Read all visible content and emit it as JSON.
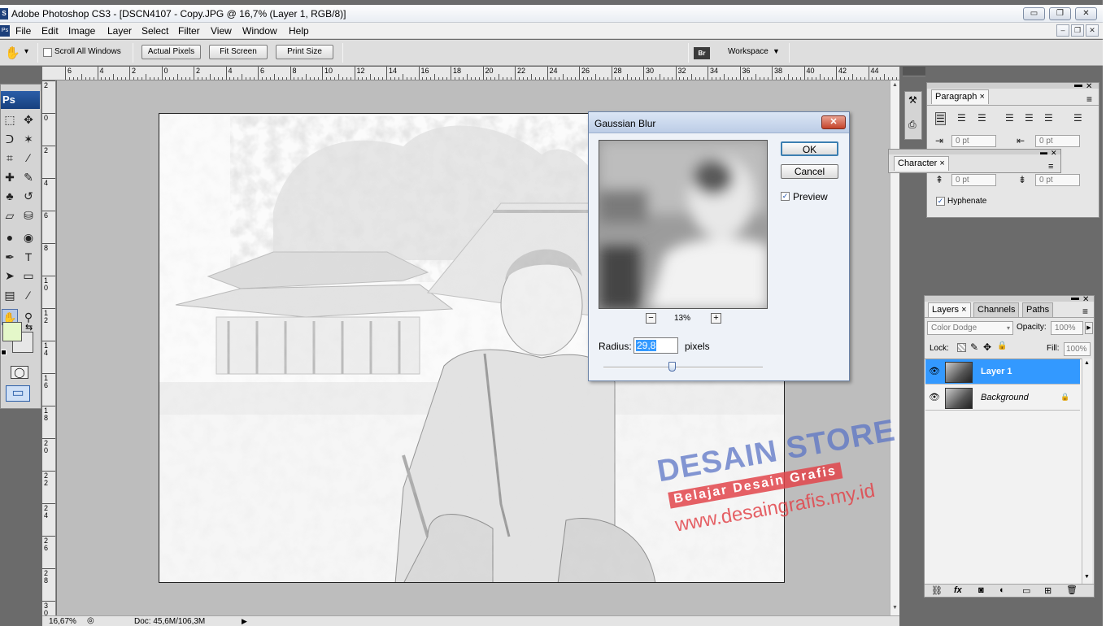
{
  "app": {
    "title": "Adobe Photoshop CS3 - [DSCN4107 - Copy.JPG @ 16,7% (Layer 1, RGB/8)]",
    "ps_badge": "Ps",
    "ps_tiny": "S"
  },
  "window_controls": {
    "minimize": "▭",
    "restore": "❐",
    "close": "✕"
  },
  "mdi_controls": {
    "minimize": "–",
    "restore": "❐",
    "close": "✕"
  },
  "menu": [
    "File",
    "Edit",
    "Image",
    "Layer",
    "Select",
    "Filter",
    "View",
    "Window",
    "Help"
  ],
  "options": {
    "scroll_all": "Scroll All Windows",
    "actual_pixels": "Actual Pixels",
    "fit_screen": "Fit Screen",
    "print_size": "Print Size",
    "workspace": "Workspace",
    "workspace_arrow": "▼",
    "bridge_label": "Br",
    "hand_glyph": "✋",
    "dropdown_glyph": "▾"
  },
  "ruler": {
    "top": [
      "6",
      "4",
      "2",
      "0",
      "2",
      "4",
      "6",
      "8",
      "10",
      "12",
      "14",
      "16",
      "18",
      "20",
      "22",
      "24",
      "26",
      "28",
      "30",
      "32",
      "34",
      "36",
      "38",
      "40",
      "42",
      "44"
    ],
    "left": [
      "2",
      "0",
      "2",
      "4",
      "6",
      "8",
      "10",
      "12",
      "14",
      "16",
      "18",
      "20",
      "22",
      "24",
      "26",
      "28",
      "30"
    ]
  },
  "toolbox": {
    "tools": [
      {
        "name": "marquee-tool-icon",
        "glyph": "⬚"
      },
      {
        "name": "move-tool-icon",
        "glyph": "✥"
      },
      {
        "name": "lasso-tool-icon",
        "glyph": "ᑐ"
      },
      {
        "name": "magic-wand-icon",
        "glyph": "✶"
      },
      {
        "name": "crop-tool-icon",
        "glyph": "⌗"
      },
      {
        "name": "slice-tool-icon",
        "glyph": "⁄"
      },
      {
        "name": "healing-brush-icon",
        "glyph": "✚"
      },
      {
        "name": "brush-tool-icon",
        "glyph": "✎"
      },
      {
        "name": "clone-stamp-icon",
        "glyph": "♣"
      },
      {
        "name": "history-brush-icon",
        "glyph": "↺"
      },
      {
        "name": "eraser-tool-icon",
        "glyph": "▱"
      },
      {
        "name": "paint-bucket-icon",
        "glyph": "⛁"
      },
      {
        "name": "blur-tool-icon",
        "glyph": "●"
      },
      {
        "name": "dodge-tool-icon",
        "glyph": "◉"
      },
      {
        "name": "pen-tool-icon",
        "glyph": "✒"
      },
      {
        "name": "type-tool-icon",
        "glyph": "T"
      },
      {
        "name": "path-selection-icon",
        "glyph": "➤"
      },
      {
        "name": "shape-tool-icon",
        "glyph": "▭"
      },
      {
        "name": "notes-tool-icon",
        "glyph": "▤"
      },
      {
        "name": "eyedropper-icon",
        "glyph": "⁄"
      },
      {
        "name": "hand-tool-icon",
        "glyph": "✋"
      },
      {
        "name": "zoom-tool-icon",
        "glyph": "⚲"
      }
    ],
    "fg_color": "#e4f7c9",
    "bg_color": "#e7e7e7",
    "swap_glyph": "⇆",
    "quickmask_glyph": "◯",
    "screenmode_glyph": "▭"
  },
  "status": {
    "zoom": "16,67%",
    "doc": "Doc: 45,6M/106,3M",
    "arrow": "▶",
    "nav_icon": "◎"
  },
  "scroll_arrows": {
    "up": "▲",
    "down": "▼"
  },
  "gaussian_blur": {
    "title": "Gaussian Blur",
    "close": "✕",
    "ok": "OK",
    "cancel": "Cancel",
    "preview_label": "Preview",
    "preview_checked": "✓",
    "zoom_out": "−",
    "zoom_in": "+",
    "zoom": "13%",
    "radius_label": "Radius:",
    "radius_value": "29,8",
    "unit": "pixels",
    "slider_position": 0.43
  },
  "paragraph_panel": {
    "tab": "Paragraph",
    "tab_close": "×",
    "left_indent": "0 pt",
    "right_indent": "0 pt",
    "space_before": "0 pt",
    "space_after": "0 pt",
    "hyphenate": "Hyphenate",
    "hyphenate_checked": "✓",
    "menu_glyph": "≡",
    "align_glyph": "☰"
  },
  "character_panel": {
    "tab": "Character",
    "tab_close": "×"
  },
  "layers_panel": {
    "tabs": [
      "Layers",
      "Channels",
      "Paths"
    ],
    "tab_close": "×",
    "blend_mode": "Color Dodge",
    "opacity_label": "Opacity:",
    "opacity": "100%",
    "lock_label": "Lock:",
    "fill_label": "Fill:",
    "fill": "100%",
    "layers": [
      {
        "name": "Layer 1",
        "selected": true
      },
      {
        "name": "Background",
        "selected": false
      }
    ],
    "lock_glyph": "🔒",
    "eye_glyph": "👁",
    "footer_icons": [
      "⛓",
      "fx",
      "◙",
      "◐",
      "▭",
      "⊞",
      "🗑"
    ]
  },
  "watermark": {
    "brand": "DESAIN STORE",
    "tagline": "Belajar Desain Grafis",
    "url": "www.desaingrafis.my.id"
  },
  "colors": {
    "accent": "#3399ff",
    "watermark_blue": "#5b74c6",
    "watermark_red": "#e2454b"
  }
}
